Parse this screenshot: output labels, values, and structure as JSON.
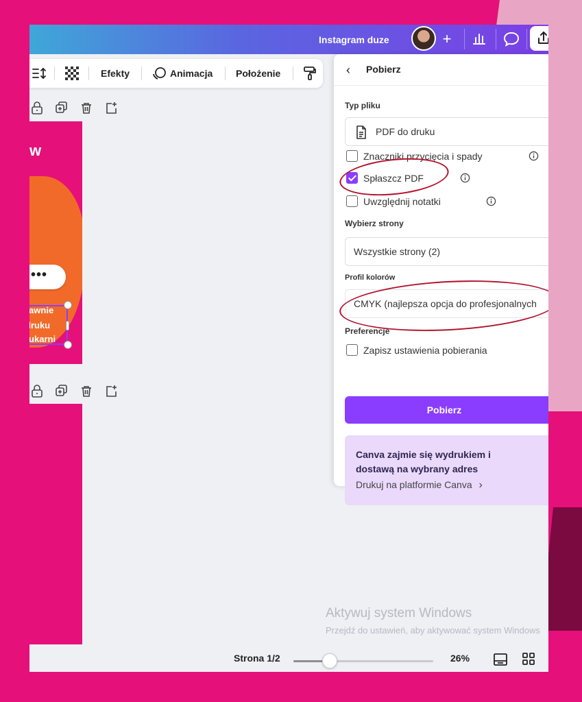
{
  "header": {
    "doc_title": "Instagram duze",
    "plus": "+"
  },
  "toolbar": {
    "effects": "Efekty",
    "animation": "Animacja",
    "position": "Położenie"
  },
  "design": {
    "logo_letter": "w",
    "context_menu": "•••",
    "text_lines": [
      "rawnie",
      "druku",
      "rukarni"
    ]
  },
  "panel": {
    "title": "Pobierz",
    "file_type_label": "Typ pliku",
    "file_type_value": "PDF do druku",
    "checkboxes": [
      {
        "label": "Znaczniki przycięcia i spady",
        "checked": false
      },
      {
        "label": "Spłaszcz PDF",
        "checked": true
      },
      {
        "label": "Uwzględnij notatki",
        "checked": false
      }
    ],
    "pages_label": "Wybierz strony",
    "pages_value": "Wszystkie strony (2)",
    "color_profile_label": "Profil kolorów",
    "color_profile_value": "CMYK (najlepsza opcja do profesjonalnych",
    "preferences_label": "Preferencje",
    "save_settings_label": "Zapisz ustawienia pobierania",
    "save_settings_checked": false,
    "download_button": "Pobierz",
    "promo_title": "Canva zajmie się wydrukiem i dostawą na wybrany adres",
    "promo_link": "Drukuj na platformie Canva",
    "promo_chevron": "›"
  },
  "footer": {
    "page_indicator": "Strona 1/2",
    "zoom": "26%",
    "zoom_fraction": 0.26
  },
  "watermark": {
    "line1": "Aktywuj system Windows",
    "line2": "Przejdź do ustawień, aby aktywować system Windows"
  },
  "colors": {
    "brand_pink": "#e6107a",
    "accent_purple": "#8b3dff",
    "annotation_red": "#b3122e",
    "orange": "#f26a2a"
  }
}
